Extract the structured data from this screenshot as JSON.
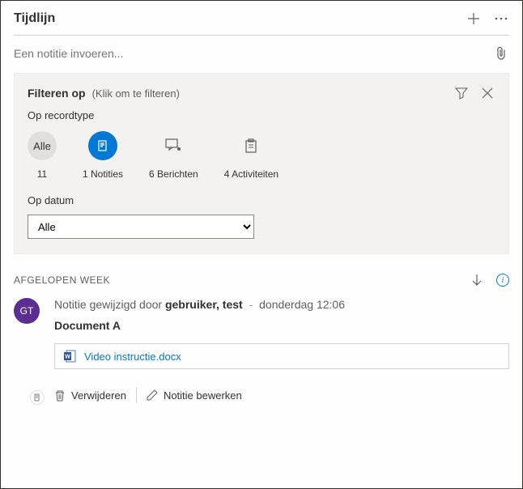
{
  "header": {
    "title": "Tijdlijn"
  },
  "noteInput": {
    "placeholder": "Een notitie invoeren..."
  },
  "filter": {
    "label": "Filteren op",
    "hint": "(Klik om te filteren)",
    "recordTypeLabel": "Op recordtype",
    "dateLabel": "Op datum",
    "types": {
      "all": {
        "chip": "Alle",
        "caption": "11"
      },
      "notes": {
        "caption": "1 Notities"
      },
      "posts": {
        "caption": "6 Berichten"
      },
      "activities": {
        "caption": "4 Activiteiten"
      }
    },
    "dateSelect": "Alle"
  },
  "section": {
    "label": "AFGELOPEN WEEK"
  },
  "entry": {
    "avatar": "GT",
    "metaPrefix": "Notitie gewijzigd door ",
    "user": "gebruiker, test",
    "metaSep": "-",
    "timestamp": "donderdag 12:06",
    "title": "Document A",
    "attachment": "Video instructie.docx",
    "actions": {
      "delete": "Verwijderen",
      "edit": "Notitie bewerken"
    }
  }
}
